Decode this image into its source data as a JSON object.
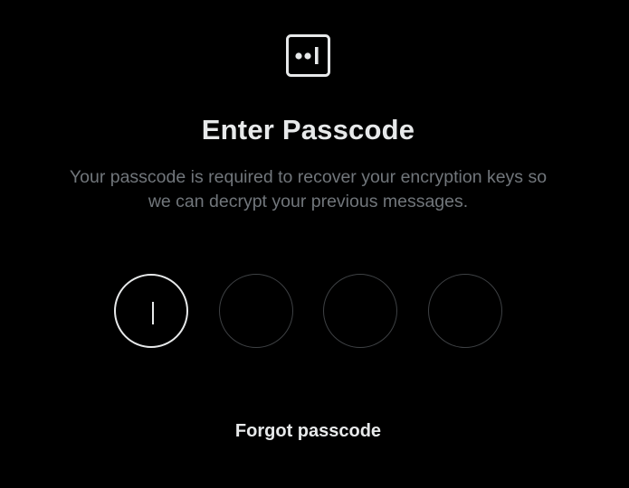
{
  "header": {
    "icon": "message-lock-icon",
    "title": "Enter Passcode",
    "subtitle_line1": "Your passcode is required to recover your encryption keys so",
    "subtitle_line2": "we can decrypt your previous messages."
  },
  "passcode": {
    "digit_count": 4,
    "active_index": 0,
    "values": [
      "",
      "",
      "",
      ""
    ]
  },
  "footer": {
    "forgot_label": "Forgot passcode"
  },
  "colors": {
    "background": "#000000",
    "text_primary": "#e7e9ea",
    "text_secondary": "#71767b",
    "digit_border": "#3e4144",
    "digit_border_active": "#e7e9ea"
  }
}
